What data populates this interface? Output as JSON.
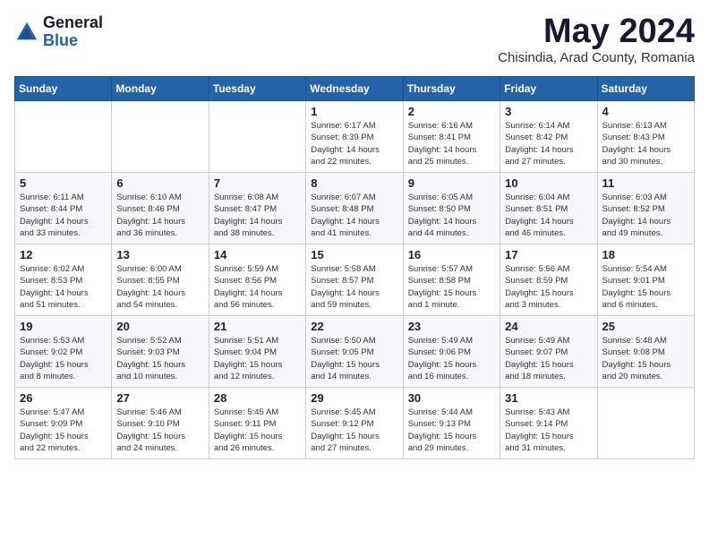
{
  "logo": {
    "general": "General",
    "blue": "Blue"
  },
  "title": "May 2024",
  "location": "Chisindia, Arad County, Romania",
  "weekdays": [
    "Sunday",
    "Monday",
    "Tuesday",
    "Wednesday",
    "Thursday",
    "Friday",
    "Saturday"
  ],
  "weeks": [
    [
      {
        "day": "",
        "info": ""
      },
      {
        "day": "",
        "info": ""
      },
      {
        "day": "",
        "info": ""
      },
      {
        "day": "1",
        "info": "Sunrise: 6:17 AM\nSunset: 8:39 PM\nDaylight: 14 hours\nand 22 minutes."
      },
      {
        "day": "2",
        "info": "Sunrise: 6:16 AM\nSunset: 8:41 PM\nDaylight: 14 hours\nand 25 minutes."
      },
      {
        "day": "3",
        "info": "Sunrise: 6:14 AM\nSunset: 8:42 PM\nDaylight: 14 hours\nand 27 minutes."
      },
      {
        "day": "4",
        "info": "Sunrise: 6:13 AM\nSunset: 8:43 PM\nDaylight: 14 hours\nand 30 minutes."
      }
    ],
    [
      {
        "day": "5",
        "info": "Sunrise: 6:11 AM\nSunset: 8:44 PM\nDaylight: 14 hours\nand 33 minutes."
      },
      {
        "day": "6",
        "info": "Sunrise: 6:10 AM\nSunset: 8:46 PM\nDaylight: 14 hours\nand 36 minutes."
      },
      {
        "day": "7",
        "info": "Sunrise: 6:08 AM\nSunset: 8:47 PM\nDaylight: 14 hours\nand 38 minutes."
      },
      {
        "day": "8",
        "info": "Sunrise: 6:07 AM\nSunset: 8:48 PM\nDaylight: 14 hours\nand 41 minutes."
      },
      {
        "day": "9",
        "info": "Sunrise: 6:05 AM\nSunset: 8:50 PM\nDaylight: 14 hours\nand 44 minutes."
      },
      {
        "day": "10",
        "info": "Sunrise: 6:04 AM\nSunset: 8:51 PM\nDaylight: 14 hours\nand 46 minutes."
      },
      {
        "day": "11",
        "info": "Sunrise: 6:03 AM\nSunset: 8:52 PM\nDaylight: 14 hours\nand 49 minutes."
      }
    ],
    [
      {
        "day": "12",
        "info": "Sunrise: 6:02 AM\nSunset: 8:53 PM\nDaylight: 14 hours\nand 51 minutes."
      },
      {
        "day": "13",
        "info": "Sunrise: 6:00 AM\nSunset: 8:55 PM\nDaylight: 14 hours\nand 54 minutes."
      },
      {
        "day": "14",
        "info": "Sunrise: 5:59 AM\nSunset: 8:56 PM\nDaylight: 14 hours\nand 56 minutes."
      },
      {
        "day": "15",
        "info": "Sunrise: 5:58 AM\nSunset: 8:57 PM\nDaylight: 14 hours\nand 59 minutes."
      },
      {
        "day": "16",
        "info": "Sunrise: 5:57 AM\nSunset: 8:58 PM\nDaylight: 15 hours\nand 1 minute."
      },
      {
        "day": "17",
        "info": "Sunrise: 5:56 AM\nSunset: 8:59 PM\nDaylight: 15 hours\nand 3 minutes."
      },
      {
        "day": "18",
        "info": "Sunrise: 5:54 AM\nSunset: 9:01 PM\nDaylight: 15 hours\nand 6 minutes."
      }
    ],
    [
      {
        "day": "19",
        "info": "Sunrise: 5:53 AM\nSunset: 9:02 PM\nDaylight: 15 hours\nand 8 minutes."
      },
      {
        "day": "20",
        "info": "Sunrise: 5:52 AM\nSunset: 9:03 PM\nDaylight: 15 hours\nand 10 minutes."
      },
      {
        "day": "21",
        "info": "Sunrise: 5:51 AM\nSunset: 9:04 PM\nDaylight: 15 hours\nand 12 minutes."
      },
      {
        "day": "22",
        "info": "Sunrise: 5:50 AM\nSunset: 9:05 PM\nDaylight: 15 hours\nand 14 minutes."
      },
      {
        "day": "23",
        "info": "Sunrise: 5:49 AM\nSunset: 9:06 PM\nDaylight: 15 hours\nand 16 minutes."
      },
      {
        "day": "24",
        "info": "Sunrise: 5:49 AM\nSunset: 9:07 PM\nDaylight: 15 hours\nand 18 minutes."
      },
      {
        "day": "25",
        "info": "Sunrise: 5:48 AM\nSunset: 9:08 PM\nDaylight: 15 hours\nand 20 minutes."
      }
    ],
    [
      {
        "day": "26",
        "info": "Sunrise: 5:47 AM\nSunset: 9:09 PM\nDaylight: 15 hours\nand 22 minutes."
      },
      {
        "day": "27",
        "info": "Sunrise: 5:46 AM\nSunset: 9:10 PM\nDaylight: 15 hours\nand 24 minutes."
      },
      {
        "day": "28",
        "info": "Sunrise: 5:45 AM\nSunset: 9:11 PM\nDaylight: 15 hours\nand 26 minutes."
      },
      {
        "day": "29",
        "info": "Sunrise: 5:45 AM\nSunset: 9:12 PM\nDaylight: 15 hours\nand 27 minutes."
      },
      {
        "day": "30",
        "info": "Sunrise: 5:44 AM\nSunset: 9:13 PM\nDaylight: 15 hours\nand 29 minutes."
      },
      {
        "day": "31",
        "info": "Sunrise: 5:43 AM\nSunset: 9:14 PM\nDaylight: 15 hours\nand 31 minutes."
      },
      {
        "day": "",
        "info": ""
      }
    ]
  ]
}
